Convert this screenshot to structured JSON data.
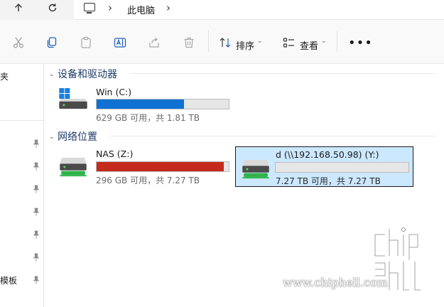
{
  "address": {
    "back_icon": "up-arrow-icon",
    "refresh_icon": "refresh-icon",
    "location": "此电脑"
  },
  "toolbar": {
    "sort_label": "排序",
    "view_label": "查看"
  },
  "leftnav": {
    "fragments": [
      "夹",
      "模板"
    ]
  },
  "groups": {
    "devices": "设备和驱动器",
    "network": "网络位置"
  },
  "drives": [
    {
      "name": "Win (C:)",
      "info": "629 GB 可用，共 1.81 TB",
      "used_fraction": 0.66,
      "bar_color": "#0f72d2"
    },
    {
      "name": "NAS (Z:)",
      "info": "296 GB 可用，共 7.27 TB",
      "used_fraction": 0.96,
      "bar_color": "#c42b1c"
    },
    {
      "name": "d (\\\\192.168.50.98) (Y:)",
      "info": "7.27 TB 可用，共 7.27 TB",
      "used_fraction": 0.0,
      "bar_color": "#0f72d2"
    }
  ],
  "watermark": {
    "url": "www.chiphell.com"
  },
  "colors": {
    "selection": "#cce8ff",
    "usage_normal": "#0f72d2",
    "usage_full": "#c42b1c",
    "group_heading": "#1e3a68"
  }
}
